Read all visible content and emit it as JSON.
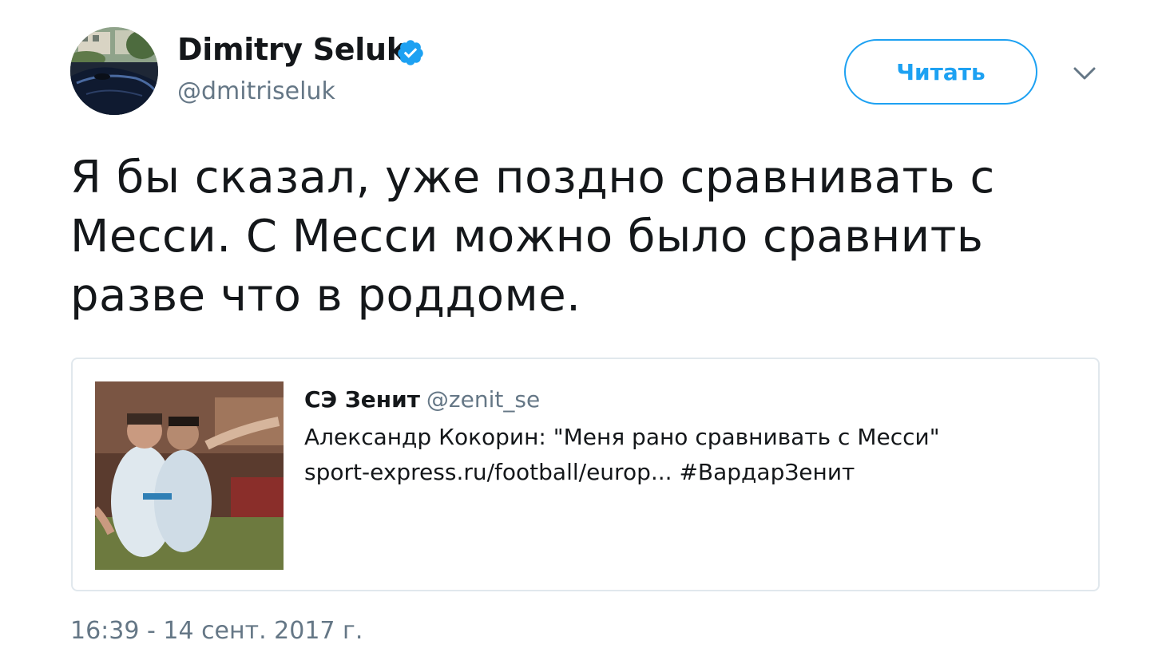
{
  "author": {
    "name": "Dimitry Seluk",
    "handle": "@dmitriseluk",
    "verified": true
  },
  "follow_button": {
    "label": "Читать"
  },
  "tweet": {
    "lines": [
      "Я бы сказал, уже поздно сравнивать с",
      "Месси. С Месси можно было сравнить",
      "разве что в роддоме."
    ]
  },
  "quote": {
    "author_name": "СЭ Зенит",
    "author_handle": "@zenit_se",
    "line1": "Александр Кокорин: \"Меня рано сравнивать с Месси\"",
    "line2": "sport-express.ru/football/europ... #ВардарЗенит"
  },
  "timestamp": "16:39 - 14 сент. 2017 г.",
  "colors": {
    "accent": "#1da1f2",
    "text": "#14171a",
    "secondary_text": "#657786",
    "border": "#e1e8ed"
  },
  "icons": {
    "verified": "verified-badge-icon",
    "menu": "chevron-down-icon"
  }
}
